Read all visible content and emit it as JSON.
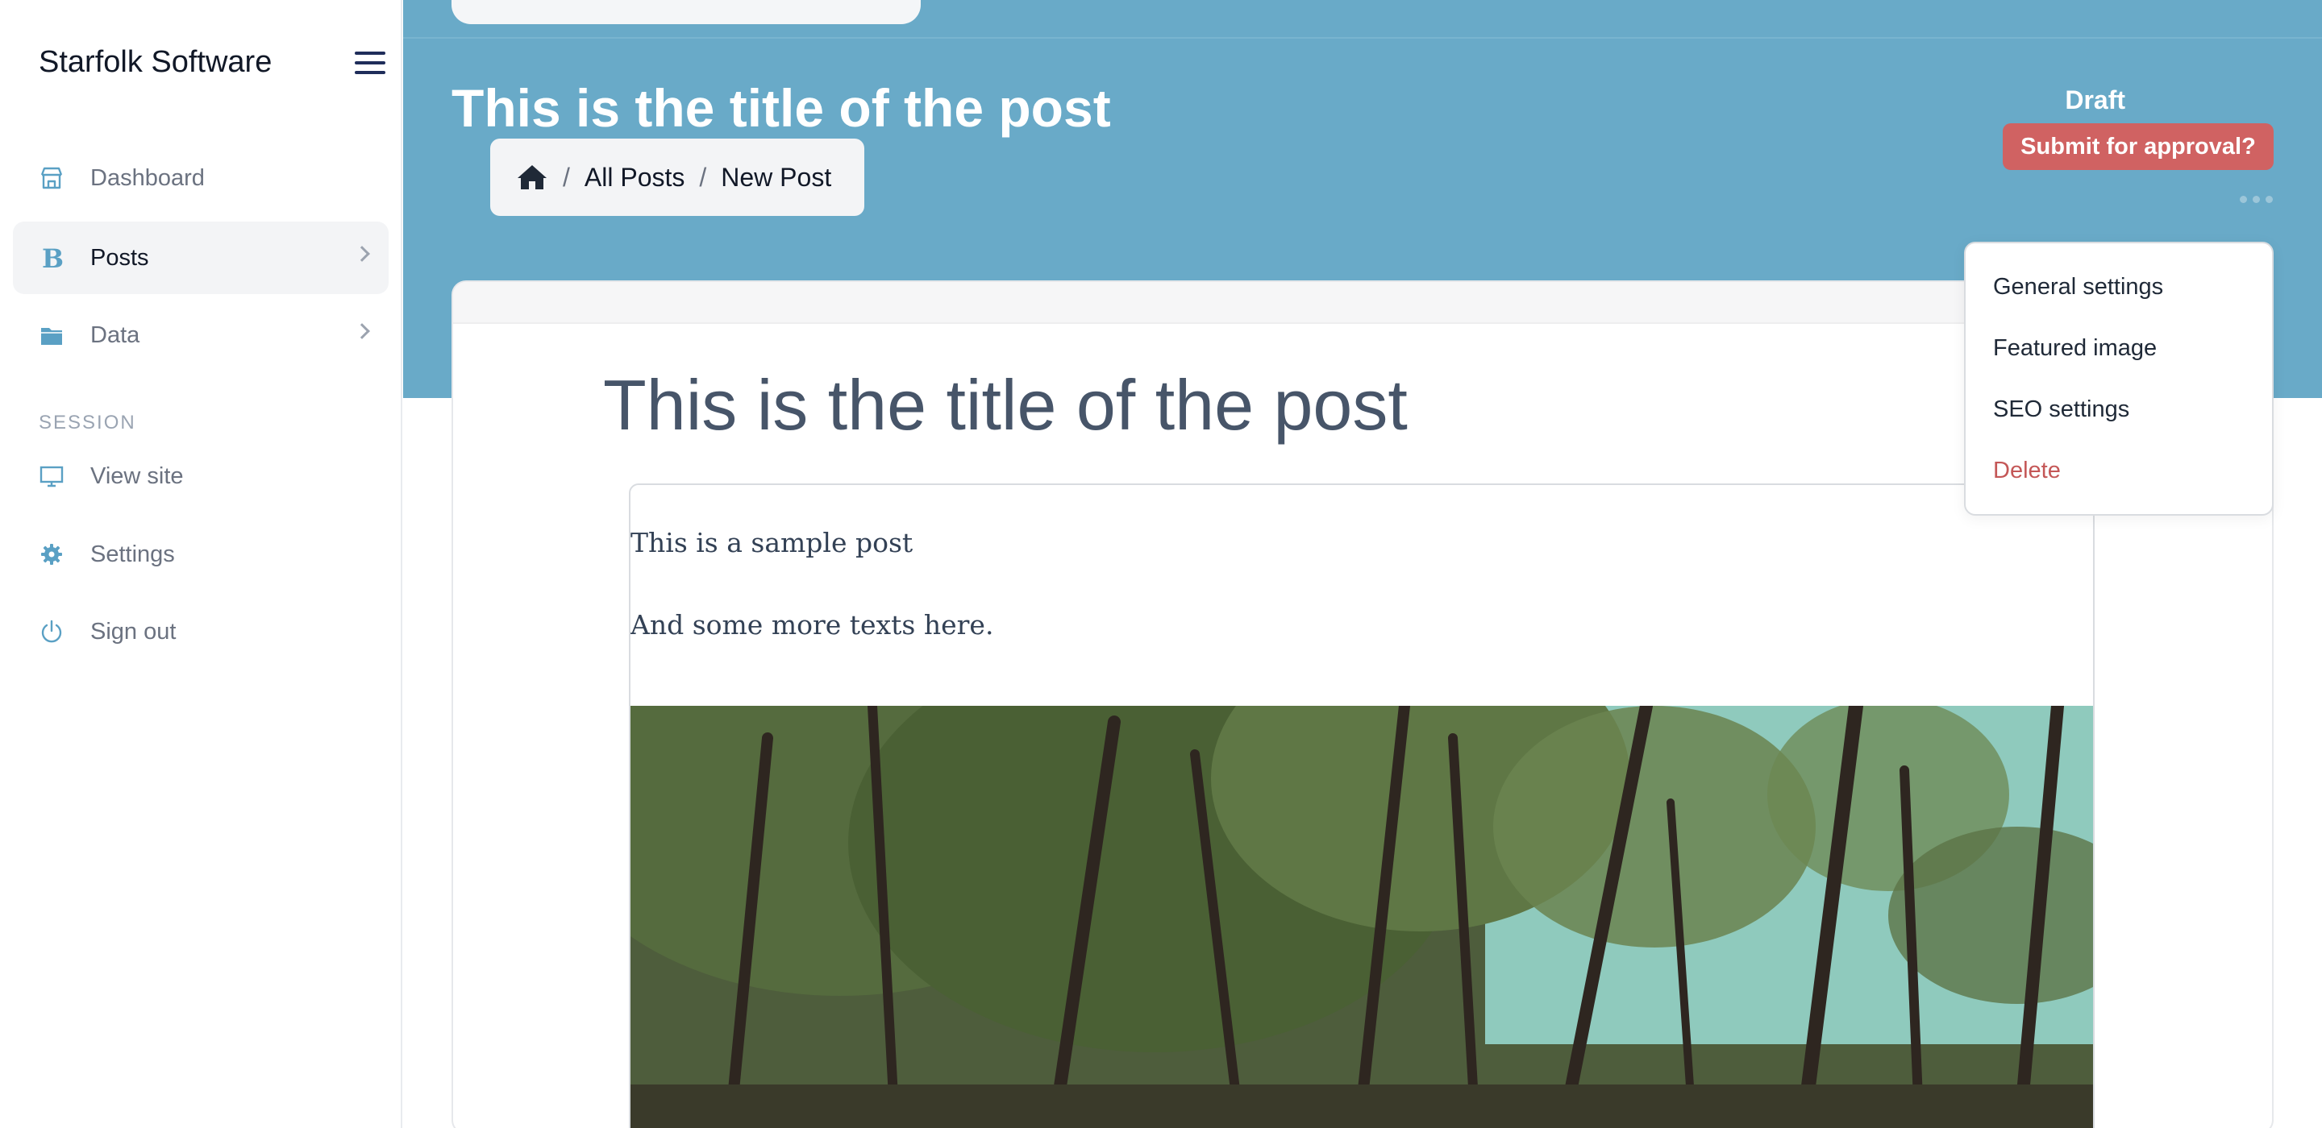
{
  "sidebar": {
    "brand": "Starfolk Software",
    "items": [
      {
        "label": "Dashboard",
        "icon": "store-icon"
      },
      {
        "label": "Posts",
        "icon": "bold-b-icon",
        "active": true
      },
      {
        "label": "Data",
        "icon": "folder-icon"
      }
    ],
    "section_label": "SESSION",
    "session_items": [
      {
        "label": "View site",
        "icon": "monitor-icon"
      },
      {
        "label": "Settings",
        "icon": "gear-icon"
      },
      {
        "label": "Sign out",
        "icon": "power-icon"
      }
    ]
  },
  "header": {
    "title": "This is the title of the post",
    "breadcrumb": [
      "All Posts",
      "New Post"
    ],
    "status": "Draft",
    "submit_label": "Submit for approval?"
  },
  "menu": {
    "items": [
      "General settings",
      "Featured image",
      "SEO settings",
      "Delete"
    ]
  },
  "editor": {
    "title": "This is the title of the post",
    "paragraphs": [
      "This is a sample post",
      "And some more texts here."
    ]
  },
  "colors": {
    "hero": "#69aac8",
    "accent_icon": "#5aa0c4",
    "submit": "#d06262",
    "danger": "#c45757"
  }
}
